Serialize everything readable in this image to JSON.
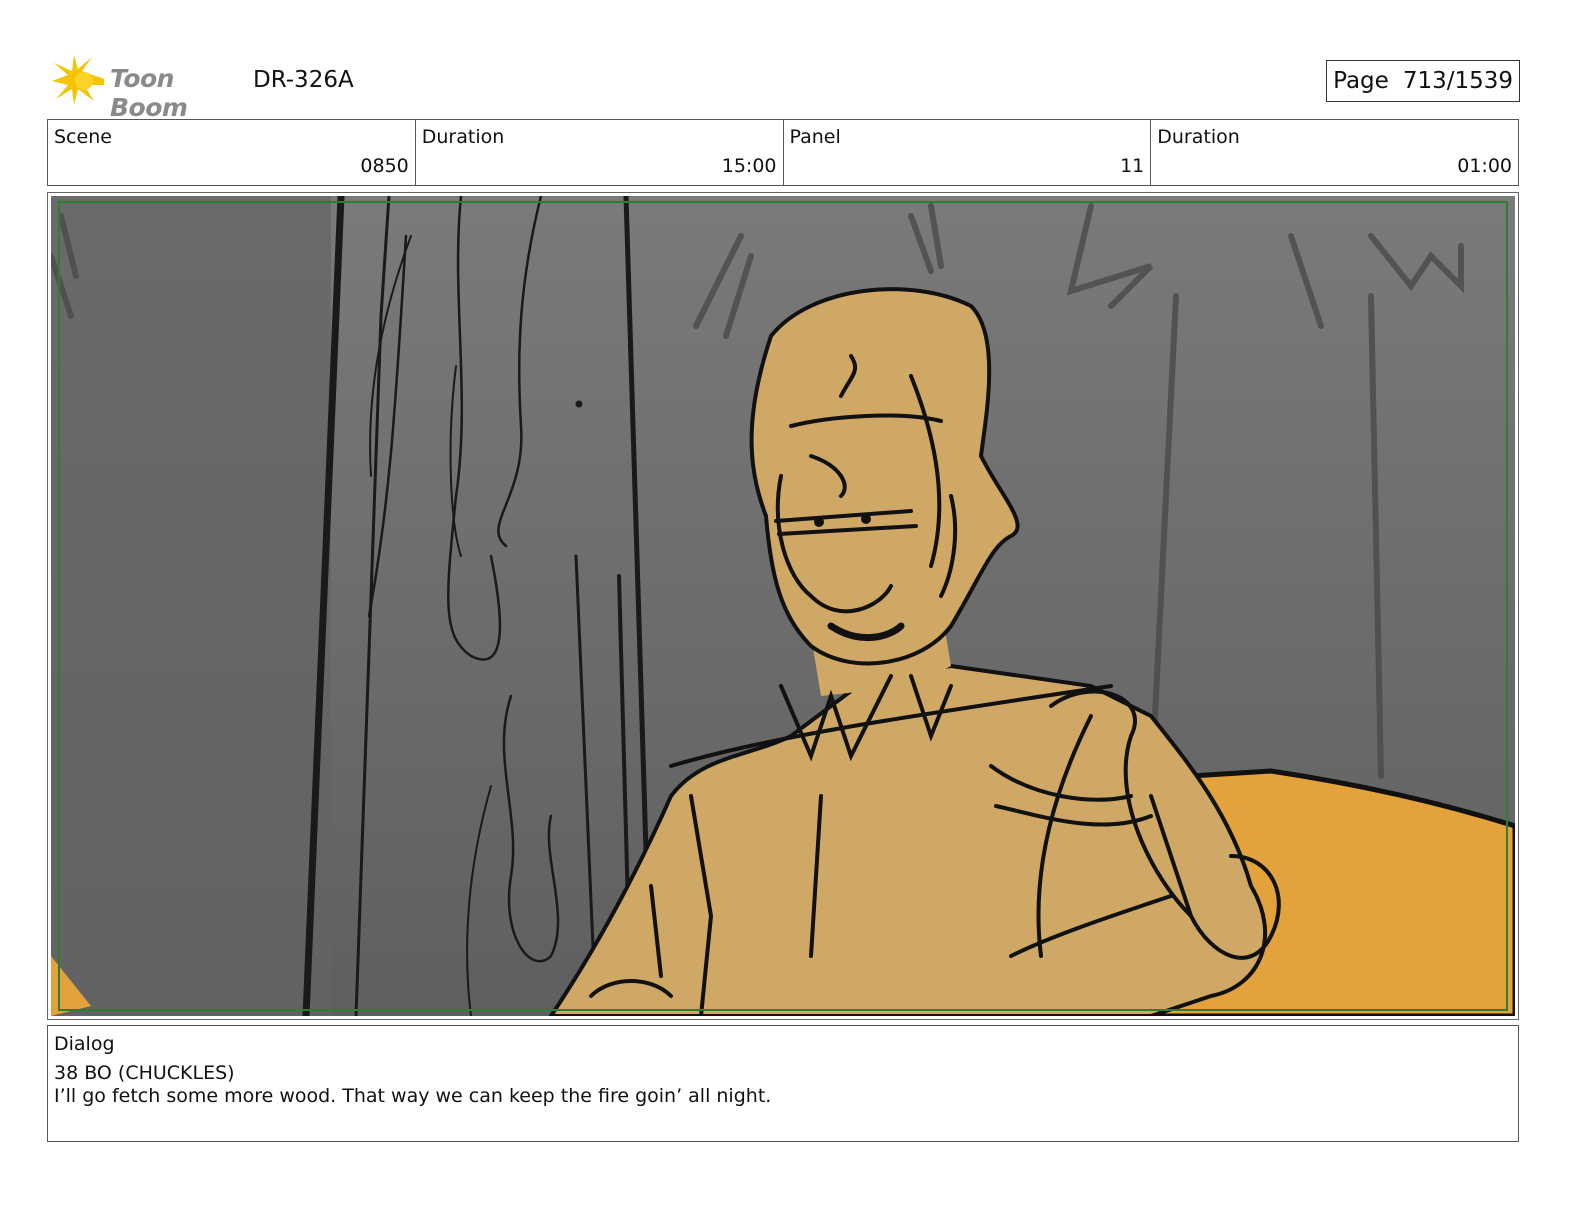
{
  "header": {
    "logo_text": "Toon Boom",
    "doc_id": "DR-326A",
    "page_label": "Page",
    "page_value": "713/1539"
  },
  "info": {
    "scene_label": "Scene",
    "scene_value": "0850",
    "scene_duration_label": "Duration",
    "scene_duration_value": "15:00",
    "panel_label": "Panel",
    "panel_value": "11",
    "panel_duration_label": "Duration",
    "panel_duration_value": "01:00"
  },
  "dialog": {
    "label": "Dialog",
    "speaker_line": "38 BO (CHUCKLES)",
    "line_text": "I’ll go fetch some more wood. That way we can keep the fire goin’ all night."
  },
  "colors": {
    "background_gray": "#6e6e6e",
    "skin_tan": "#cfa865",
    "cushion_orange": "#e3a23c",
    "safe_frame_green": "#2e7d32",
    "logo_yellow": "#f5c400"
  },
  "icons": {
    "logo": "toon-boom-starburst-icon"
  }
}
